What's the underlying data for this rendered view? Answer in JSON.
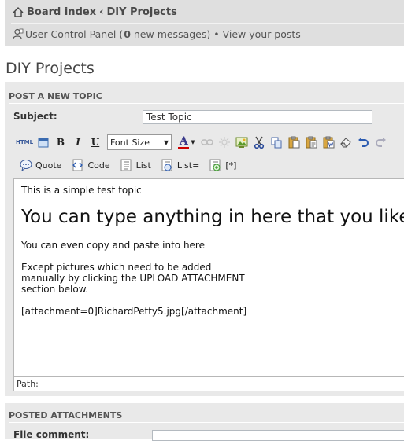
{
  "breadcrumb": {
    "home_label": "Board index",
    "separator": "‹",
    "forum_label": "DIY Projects"
  },
  "nav": {
    "ucp_label": "User Control Panel (",
    "message_count": "0",
    "messages_suffix": " new messages)",
    "bullet": " • ",
    "view_posts_label": "View your posts"
  },
  "page": {
    "title": "DIY Projects"
  },
  "form": {
    "section_heading": "POST A NEW TOPIC",
    "subject_label": "Subject:",
    "subject_value": "Test Topic"
  },
  "toolbar": {
    "html_label": "HTML",
    "bold_label": "B",
    "italic_label": "I",
    "underline_label": "U",
    "font_size_label": "Font Size",
    "font_color_label": "A",
    "quote_label": "Quote",
    "code_label": "Code",
    "list_label": "List",
    "list_ordered_label": "List=",
    "list_item_label": "[*]"
  },
  "editor": {
    "line1": "This is a simple test topic",
    "line2": "You can type anything in here that you like.",
    "line3": "You can even copy and paste into here",
    "line4": "Except pictures which need to be added",
    "line5": "manually by clicking the UPLOAD ATTACHMENT",
    "line6": "section below.",
    "line7": "[attachment=0]RichardPetty5.jpg[/attachment]",
    "path_label": "Path:"
  },
  "attachments": {
    "section_heading": "POSTED ATTACHMENTS",
    "file_comment_label": "File comment:"
  },
  "colors": {
    "panel_bg": "#e9e9e9",
    "navbar_bg": "#dfdfdf",
    "font_color_bar": "#cc0000"
  }
}
